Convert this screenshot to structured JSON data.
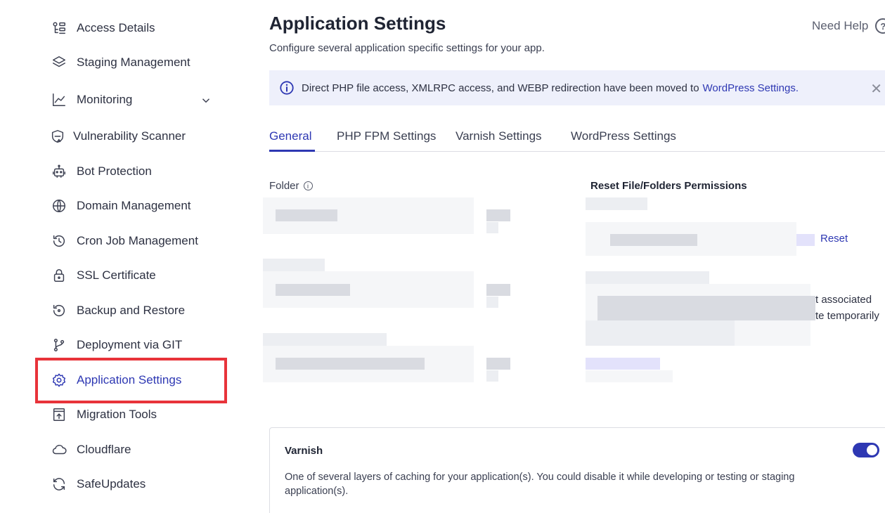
{
  "sidebar": {
    "items": [
      {
        "label": "Access Details",
        "icon": "access-details-icon"
      },
      {
        "label": "Staging Management",
        "icon": "layers-icon"
      },
      {
        "label": "Monitoring",
        "icon": "chart-icon"
      },
      {
        "label": "Vulnerability Scanner",
        "icon": "shield-scan-icon"
      },
      {
        "label": "Bot Protection",
        "icon": "robot-icon"
      },
      {
        "label": "Domain Management",
        "icon": "www-icon"
      },
      {
        "label": "Cron Job Management",
        "icon": "history-icon"
      },
      {
        "label": "SSL Certificate",
        "icon": "lock-icon"
      },
      {
        "label": "Backup and Restore",
        "icon": "backup-icon"
      },
      {
        "label": "Deployment via GIT",
        "icon": "git-branch-icon"
      },
      {
        "label": "Application Settings",
        "icon": "gear-icon",
        "active": true
      },
      {
        "label": "Migration Tools",
        "icon": "migration-icon"
      },
      {
        "label": "Cloudflare",
        "icon": "cloud-icon"
      },
      {
        "label": "SafeUpdates",
        "icon": "refresh-icon"
      }
    ]
  },
  "header": {
    "title": "Application Settings",
    "subtitle": "Configure several application specific settings for your app.",
    "help_label": "Need Help",
    "help_icon": "?"
  },
  "banner": {
    "text": "Direct PHP file access, XMLRPC access, and WEBP redirection have been moved to",
    "link": "WordPress Settings.",
    "close_glyph": "✕"
  },
  "tabs": [
    {
      "label": "General",
      "active": true
    },
    {
      "label": "PHP FPM Settings"
    },
    {
      "label": "Varnish Settings"
    },
    {
      "label": "WordPress Settings"
    }
  ],
  "general": {
    "folder_label": "Folder",
    "permissions_label": "Reset File/Folders Permissions",
    "reset_link": "Reset",
    "partial_text_1": "t associated",
    "partial_text_2": "te temporarily"
  },
  "varnish_card": {
    "title": "Varnish",
    "description": "One of several layers of caching for your application(s). You could disable it while developing or testing or staging application(s).",
    "enabled": true
  },
  "colors": {
    "accent": "#2e38b3",
    "banner_bg": "#eef0fb",
    "highlight": "#e8333a"
  }
}
